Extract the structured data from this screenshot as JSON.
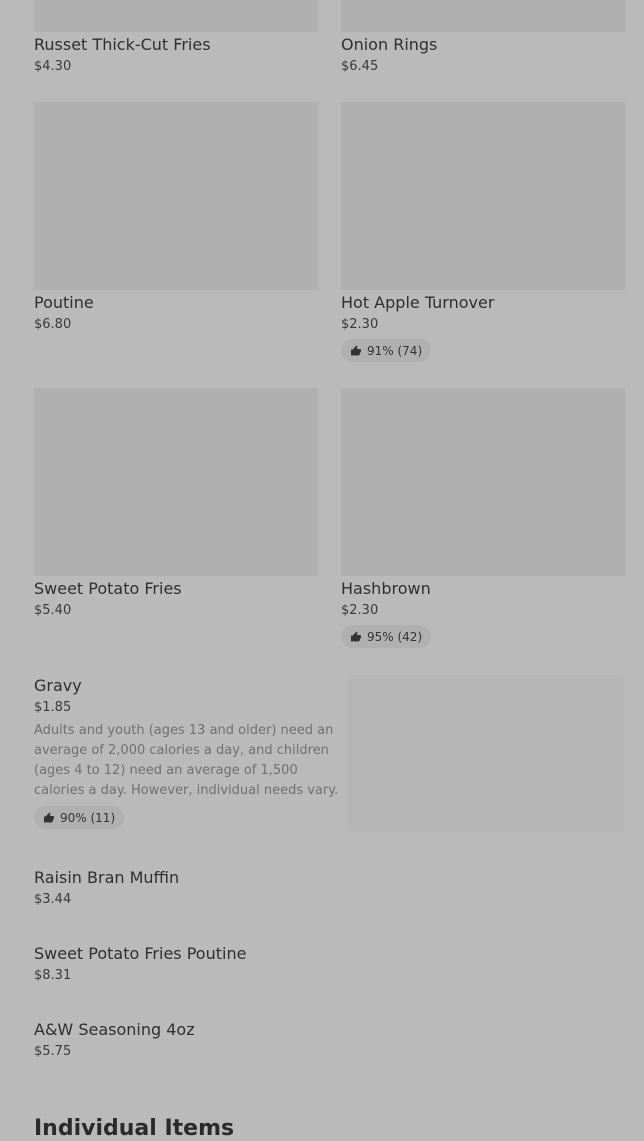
{
  "grid": [
    {
      "name": "Russet Thick-Cut Fries",
      "price": "$4.30"
    },
    {
      "name": "Onion Rings",
      "price": "$6.45"
    },
    {
      "name": "Poutine",
      "price": "$6.80"
    },
    {
      "name": "Hot Apple Turnover",
      "price": "$2.30",
      "rating": "91% (74)"
    },
    {
      "name": "Sweet Potato Fries",
      "price": "$5.40"
    },
    {
      "name": "Hashbrown",
      "price": "$2.30",
      "rating": "95% (42)"
    }
  ],
  "featured": {
    "name": "Gravy",
    "price": "$1.85",
    "description": "Adults and youth (ages 13 and older) need an average of 2,000 calories a day, and children (ages 4 to 12) need an average of 1,500 calories a day. However, individual needs vary.",
    "rating": "90% (11)"
  },
  "list": [
    {
      "name": "Raisin Bran Muffin",
      "price": "$3.44"
    },
    {
      "name": "Sweet Potato Fries Poutine",
      "price": "$8.31"
    },
    {
      "name": "A&W Seasoning 4oz",
      "price": "$5.75"
    }
  ],
  "section": {
    "title": "Individual Items"
  },
  "icons": {
    "rating": "thumbs-up-icon"
  },
  "colors": {
    "background": "#bababa",
    "image_placeholder": "#b0b0b0",
    "badge": "#b0b0b0"
  }
}
